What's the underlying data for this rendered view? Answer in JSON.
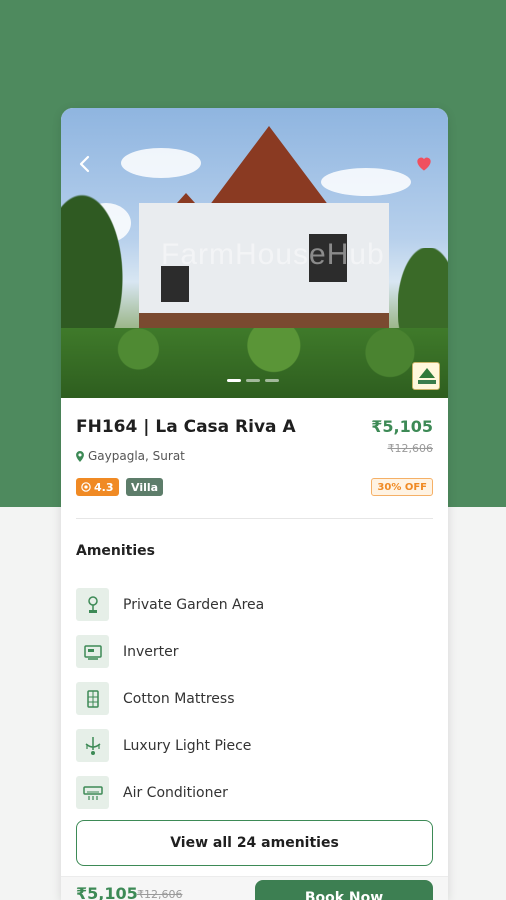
{
  "colors": {
    "background_top": "#4e8a5e",
    "accent": "#3d8a56",
    "rating_badge": "#f08a24",
    "type_badge": "#5d7d6a"
  },
  "hero": {
    "watermark": "FarmHouseHub",
    "icons": {
      "back": "chevron-left-icon",
      "favorite": "heart-icon",
      "logo": "farmhouse-logo-icon"
    },
    "carousel_dots": 3,
    "active_dot": 0
  },
  "property": {
    "title": "FH164 | La Casa Riva A",
    "price": "₹5,105",
    "old_price": "₹12,606",
    "location": "Gaypagla, Surat",
    "rating": "4.3",
    "type": "Villa",
    "discount": "30% OFF"
  },
  "amenities": {
    "heading": "Amenities",
    "items": [
      {
        "label": "Private Garden Area",
        "icon": "garden-icon"
      },
      {
        "label": "Inverter",
        "icon": "inverter-icon"
      },
      {
        "label": "Cotton Mattress",
        "icon": "mattress-icon"
      },
      {
        "label": "Luxury Light Piece",
        "icon": "chandelier-icon"
      },
      {
        "label": "Air Conditioner",
        "icon": "air-conditioner-icon"
      }
    ],
    "view_all_label": "View all 24 amenities"
  },
  "bottom_bar": {
    "price": "₹5,105",
    "old_price": "₹12,606",
    "book_label": "Book Now"
  }
}
